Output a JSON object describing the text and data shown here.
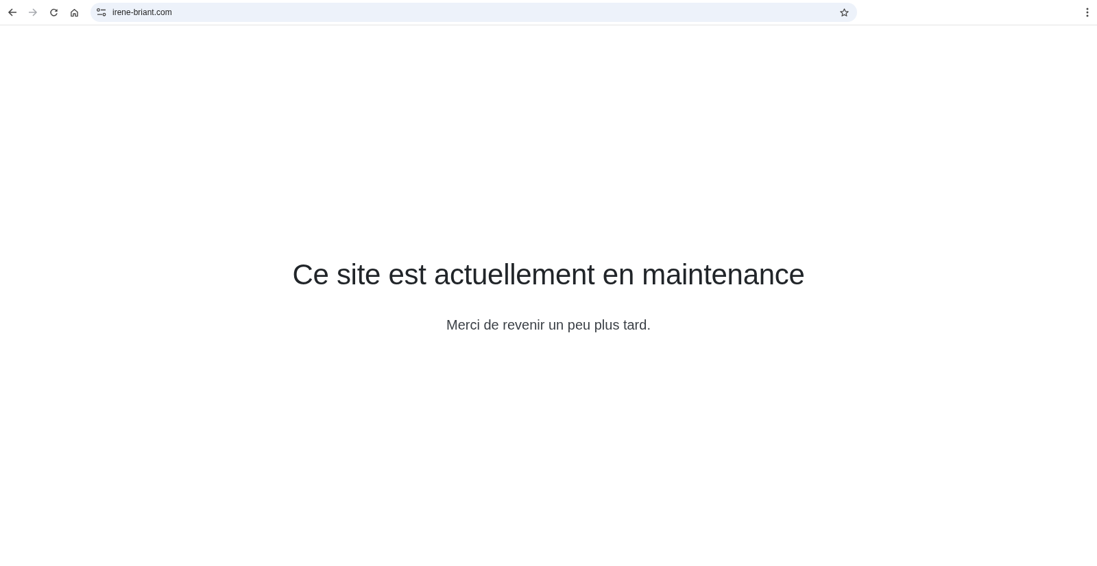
{
  "browser": {
    "nav_buttons": [
      {
        "kind": "back",
        "disabled": false
      },
      {
        "kind": "forward",
        "disabled": true
      },
      {
        "kind": "reload",
        "disabled": false
      },
      {
        "kind": "home",
        "disabled": false
      }
    ],
    "address": "irene-briant.com",
    "bookmarked": false
  },
  "page": {
    "title": "Ce site est actuellement en maintenance",
    "message": "Merci de revenir un peu plus tard."
  }
}
